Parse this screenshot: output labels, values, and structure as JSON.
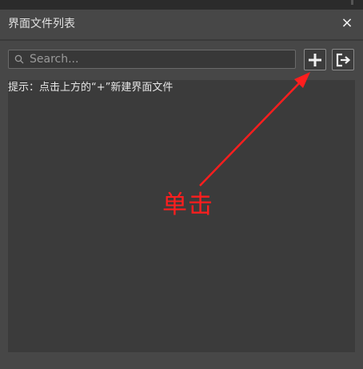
{
  "panel": {
    "title": "界面文件列表",
    "close_glyph": "×"
  },
  "search": {
    "placeholder": "Search...",
    "value": ""
  },
  "toolbar": {
    "add_icon": "plus-icon",
    "export_icon": "export-icon"
  },
  "list": {
    "hint": "提示：点击上方的“+”新建界面文件"
  },
  "annotation": {
    "label": "单击",
    "color": "#ff1e1e"
  }
}
